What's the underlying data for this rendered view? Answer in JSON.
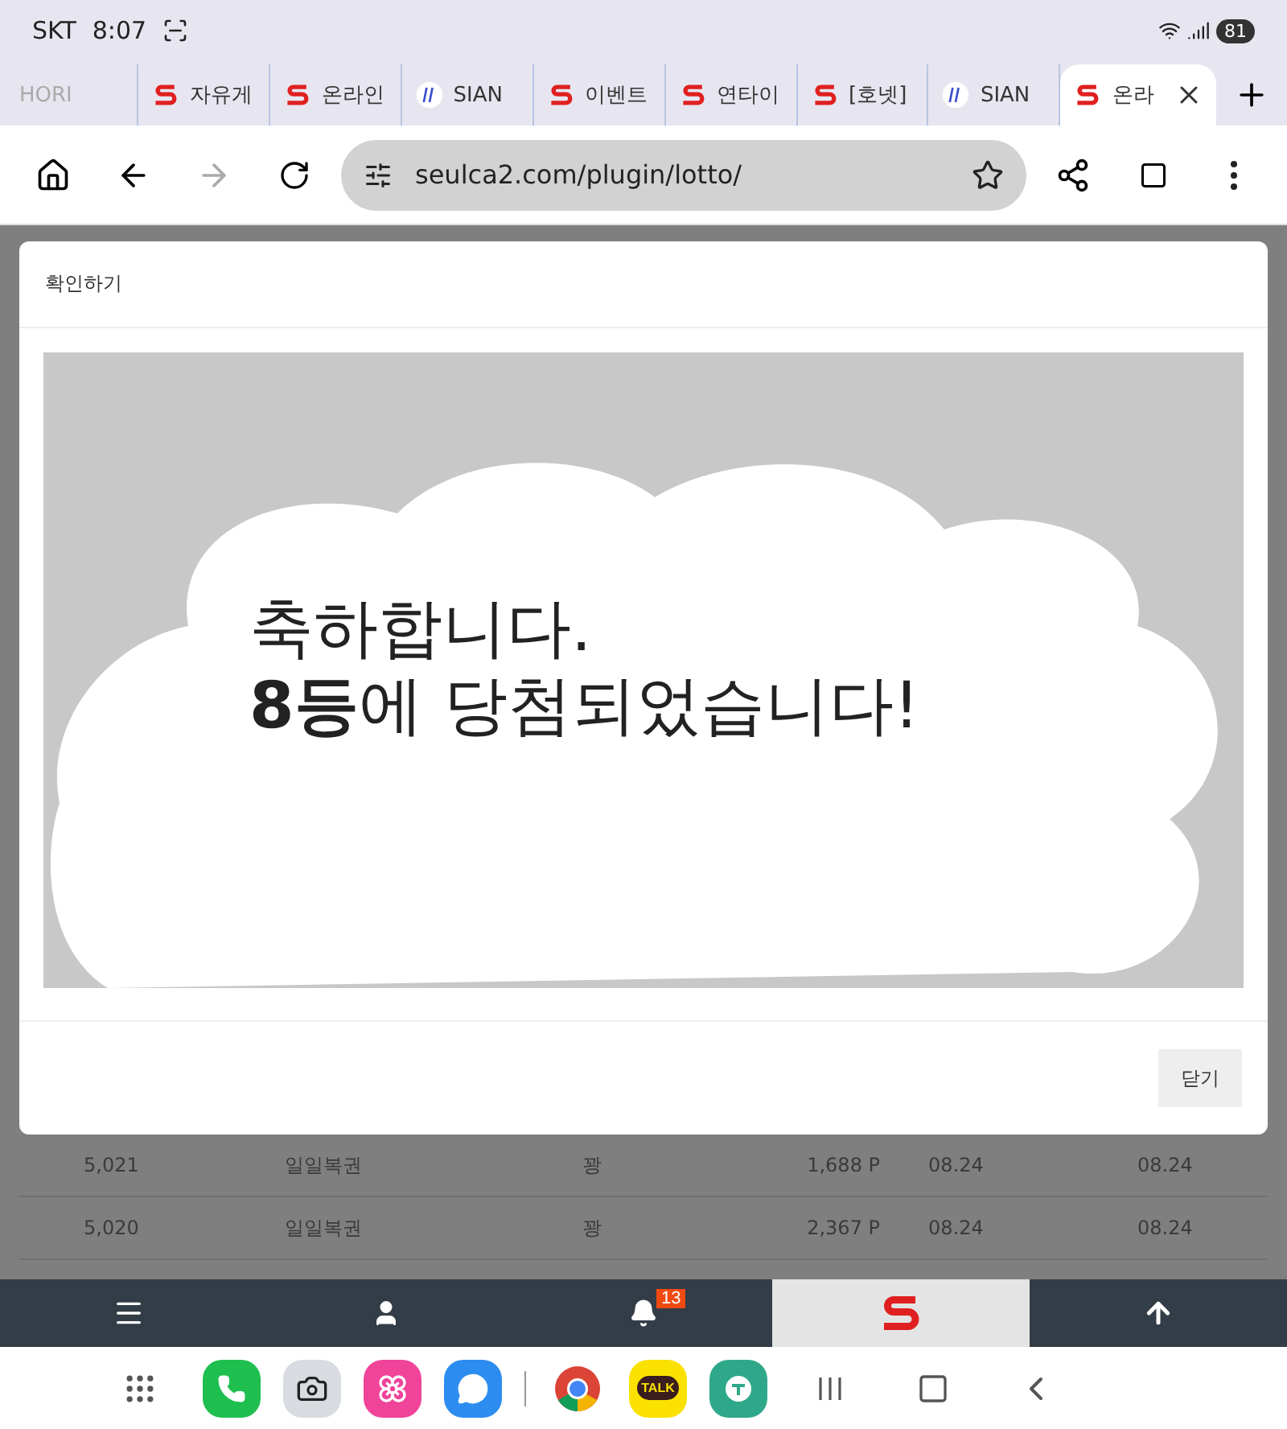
{
  "status_bar": {
    "carrier": "SKT",
    "time": "8:07",
    "battery": "81"
  },
  "tabs": [
    {
      "label": "HORI",
      "kind": "plain",
      "selected": false
    },
    {
      "label": "자유게",
      "kind": "s",
      "selected": false
    },
    {
      "label": "온라인",
      "kind": "s",
      "selected": false
    },
    {
      "label": "SIAN",
      "kind": "sian",
      "selected": false
    },
    {
      "label": "이벤트",
      "kind": "s",
      "selected": false
    },
    {
      "label": "연타이",
      "kind": "s",
      "selected": false
    },
    {
      "label": "[호넷]",
      "kind": "s",
      "selected": false
    },
    {
      "label": "SIAN",
      "kind": "sian",
      "selected": false
    },
    {
      "label": "온라",
      "kind": "s",
      "selected": true
    }
  ],
  "address_bar": {
    "url": "seulca2.com/plugin/lotto/",
    "forward_disabled": true
  },
  "dialog": {
    "title": "확인하기",
    "message_lines": [
      "축하합니다.",
      "**8등**에 당첨되었습니다!"
    ],
    "close_button": "닫기"
  },
  "table": {
    "rows": [
      {
        "cells": [
          "5,021",
          "일일복권",
          "꽝",
          "1,688 P",
          "08.24",
          "08.24"
        ]
      },
      {
        "cells": [
          "5,020",
          "일일복권",
          "꽝",
          "2,367 P",
          "08.24",
          "08.24"
        ]
      }
    ]
  },
  "bottom_nav": [
    {
      "kind": "menu",
      "selected": false
    },
    {
      "kind": "user",
      "selected": false
    },
    {
      "kind": "bell",
      "badge": "13",
      "selected": false
    },
    {
      "kind": "logo",
      "selected": true
    },
    {
      "kind": "up",
      "selected": false
    }
  ],
  "dock": [
    {
      "kind": "grid"
    },
    {
      "kind": "phone"
    },
    {
      "kind": "camera"
    },
    {
      "kind": "gallery"
    },
    {
      "kind": "messages"
    },
    {
      "kind": "divider"
    },
    {
      "kind": "chrome"
    },
    {
      "kind": "talk",
      "label": "TALK"
    },
    {
      "kind": "bank"
    },
    {
      "kind": "recents"
    },
    {
      "kind": "home"
    },
    {
      "kind": "back"
    }
  ]
}
